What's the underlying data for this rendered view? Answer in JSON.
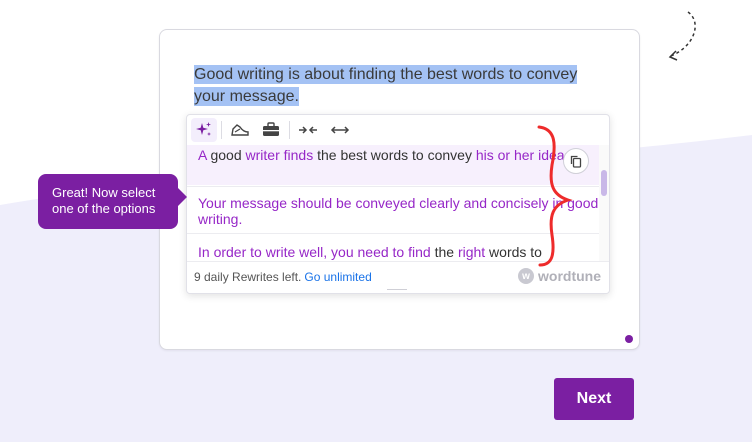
{
  "editor": {
    "selected_sentence": "Good writing is about finding the best words to convey your message."
  },
  "toolbar": {
    "icons": [
      "sparkle-icon",
      "casual-icon",
      "formal-icon",
      "shorten-icon",
      "expand-icon"
    ]
  },
  "options": [
    {
      "parts": [
        {
          "text": "A",
          "style": "changed"
        },
        {
          "text": " good ",
          "style": "same"
        },
        {
          "text": "writer finds",
          "style": "changed"
        },
        {
          "text": " the best words to convey ",
          "style": "same"
        },
        {
          "text": "his or her ideas.",
          "style": "changed"
        }
      ]
    },
    {
      "parts": [
        {
          "text": "Your message should be conveyed clearly and concisely in good writing.",
          "style": "changed"
        }
      ]
    },
    {
      "parts": [
        {
          "text": "In order to write well, you need to find",
          "style": "changed"
        },
        {
          "text": " the ",
          "style": "same"
        },
        {
          "text": "right",
          "style": "changed"
        },
        {
          "text": " words to",
          "style": "same"
        }
      ]
    }
  ],
  "footer": {
    "rewrites_text": "9 daily Rewrites left.",
    "upgrade_link": "Go unlimited",
    "brand": "wordtune"
  },
  "tooltip": {
    "text": "Great! Now select one of the options"
  },
  "next_button": {
    "label": "Next"
  },
  "colors": {
    "accent": "#7b1fa2",
    "changed_text": "#9627c7",
    "highlight": "#a4c2f4"
  }
}
